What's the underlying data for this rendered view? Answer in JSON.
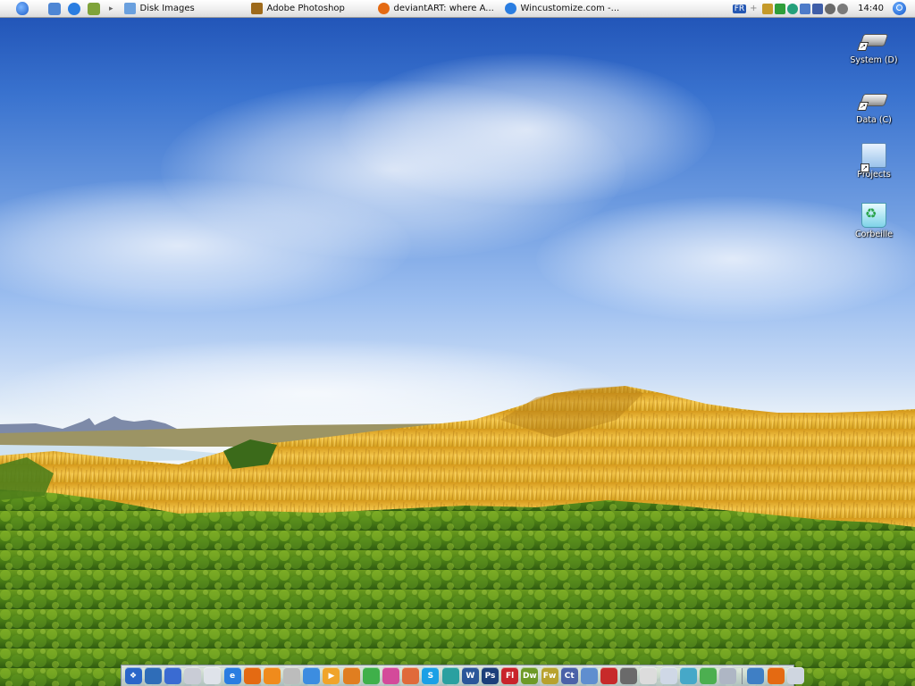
{
  "menubar": {
    "quicklaunch": [
      {
        "name": "apple-icon",
        "color": "#2c6fd6"
      },
      {
        "name": "ie-app-icon",
        "color": "#4e86d4"
      },
      {
        "name": "internet-explorer-icon",
        "color": "#2a7de1"
      },
      {
        "name": "pencil-icon",
        "color": "#7fa33a"
      }
    ],
    "tasks": [
      {
        "label": "Disk Images",
        "icon": "disk-images-icon",
        "color": "#6aa0de"
      },
      {
        "label": "Adobe Photoshop",
        "icon": "photoshop-icon",
        "color": "#9e6a1b"
      },
      {
        "label": "deviantART: where A...",
        "icon": "firefox-icon",
        "color": "#e46a12"
      },
      {
        "label": "Wincustomize.com -...",
        "icon": "internet-explorer-icon",
        "color": "#2a7de1"
      }
    ],
    "tray": {
      "language": "FR",
      "icons": [
        {
          "name": "plus-icon",
          "color": "#888888"
        },
        {
          "name": "tools-icon",
          "color": "#c59a2a"
        },
        {
          "name": "battery-icon",
          "color": "#2f9e3a"
        },
        {
          "name": "messenger-icon",
          "color": "#24a07a"
        },
        {
          "name": "network-icon",
          "color": "#4d7bc9"
        },
        {
          "name": "display-icon",
          "color": "#3f5ea8"
        },
        {
          "name": "bluetooth-icon",
          "color": "#6a6a6a"
        },
        {
          "name": "volume-icon",
          "color": "#7a7a7a"
        }
      ],
      "clock": "14:40"
    }
  },
  "desktop_icons": [
    {
      "label": "System (D)",
      "type": "drive"
    },
    {
      "label": "Data (C)",
      "type": "drive"
    },
    {
      "label": "Projects",
      "type": "folder"
    },
    {
      "label": "Corbeille",
      "type": "recycle-bin"
    }
  ],
  "dock": {
    "items": [
      {
        "name": "windows-start-icon",
        "color": "#2a66c9",
        "glyph": "❖"
      },
      {
        "name": "messenger-icon",
        "color": "#2f6db8",
        "glyph": ""
      },
      {
        "name": "window-manager-icon",
        "color": "#3a6bd2",
        "glyph": ""
      },
      {
        "name": "document-icon",
        "color": "#c9ccd6",
        "glyph": ""
      },
      {
        "name": "file-icon",
        "color": "#dfe3ea",
        "glyph": ""
      },
      {
        "name": "internet-explorer-icon",
        "color": "#2a7de1",
        "glyph": "e"
      },
      {
        "name": "firefox-icon",
        "color": "#e46a12",
        "glyph": ""
      },
      {
        "name": "winamp-icon",
        "color": "#f08b1c",
        "glyph": ""
      },
      {
        "name": "mail-icon",
        "color": "#bcbcbc",
        "glyph": ""
      },
      {
        "name": "search-icon",
        "color": "#3c8de0",
        "glyph": ""
      },
      {
        "name": "media-player-icon",
        "color": "#f0a42a",
        "glyph": "▶"
      },
      {
        "name": "tools-icon",
        "color": "#e07e20",
        "glyph": ""
      },
      {
        "name": "messenger-buddies-icon",
        "color": "#3fb04a",
        "glyph": ""
      },
      {
        "name": "chat-icon",
        "color": "#d44a9a",
        "glyph": ""
      },
      {
        "name": "recycle-icon",
        "color": "#e06a3a",
        "glyph": ""
      },
      {
        "name": "skype-icon",
        "color": "#1aa0e6",
        "glyph": "S"
      },
      {
        "name": "cap-icon",
        "color": "#2aa0a0",
        "glyph": ""
      },
      {
        "name": "word-icon",
        "color": "#2b579a",
        "glyph": "W"
      },
      {
        "name": "photoshop-icon",
        "color": "#1c3f7a",
        "glyph": "Ps"
      },
      {
        "name": "flash-icon",
        "color": "#c9232a",
        "glyph": "Fl"
      },
      {
        "name": "dreamweaver-icon",
        "color": "#6e9a27",
        "glyph": "Dw"
      },
      {
        "name": "fireworks-icon",
        "color": "#b8a22e",
        "glyph": "Fw"
      },
      {
        "name": "contribute-icon",
        "color": "#4b62a8",
        "glyph": "Ct"
      },
      {
        "name": "globe-icon",
        "color": "#5f8ecf",
        "glyph": ""
      },
      {
        "name": "acrobat-icon",
        "color": "#c72a2a",
        "glyph": ""
      },
      {
        "name": "audio-icon",
        "color": "#6a6a6a",
        "glyph": ""
      },
      {
        "name": "clock-icon",
        "color": "#dcdcdc",
        "glyph": ""
      },
      {
        "name": "calendar-icon",
        "color": "#cfd8e6",
        "glyph": ""
      },
      {
        "name": "recycle-bin-icon",
        "color": "#46a8c8",
        "glyph": ""
      },
      {
        "name": "users-icon",
        "color": "#4caf50",
        "glyph": ""
      },
      {
        "name": "monitor-icon",
        "color": "#aeb6c4",
        "glyph": ""
      },
      {
        "name": "control-panel-icon",
        "color": "#3f7fc5",
        "glyph": ""
      },
      {
        "name": "firefox-dock-icon",
        "color": "#e46a12",
        "glyph": ""
      },
      {
        "name": "desktop-icon",
        "color": "#cfd6e0",
        "glyph": ""
      }
    ]
  }
}
